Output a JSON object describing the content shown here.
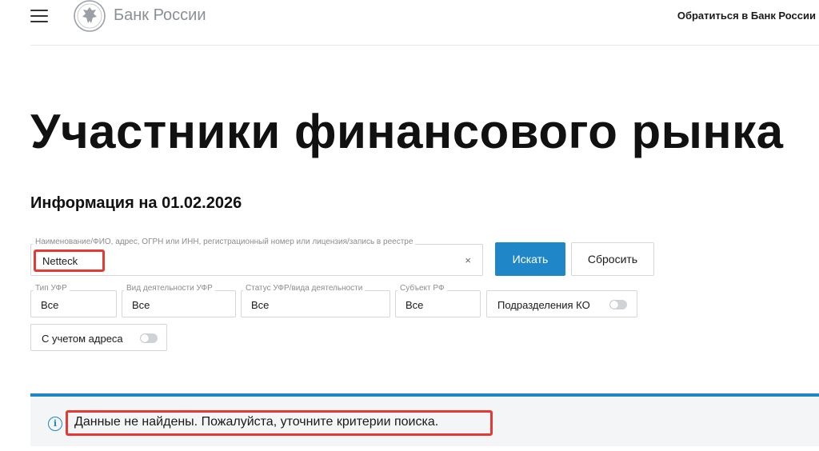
{
  "header": {
    "menu_icon": "hamburger-menu-icon",
    "logo_icon": "bank-emblem-icon",
    "logo_text": "Банк России",
    "contact_link": "Обратиться в Банк России"
  },
  "page": {
    "title": "Участники финансового рынка",
    "info_date": "Информация на 01.02.2026"
  },
  "search": {
    "label": "Наименование/ФИО, адрес, ОГРН или ИНН, регистрационный номер или лицензия/запись в реестре",
    "value": "Netteck",
    "clear_icon": "×",
    "search_button": "Искать",
    "reset_button": "Сбросить"
  },
  "filters": {
    "type": {
      "label": "Тип УФР",
      "value": "Все"
    },
    "activity": {
      "label": "Вид деятельности УФР",
      "value": "Все"
    },
    "status": {
      "label": "Статус УФР/вида деятельности",
      "value": "Все"
    },
    "subject": {
      "label": "Субъект РФ",
      "value": "Все"
    },
    "ko_toggle": {
      "label": "Подразделения КО",
      "on": false
    },
    "address_toggle": {
      "label": "С учетом адреса",
      "on": false
    }
  },
  "result": {
    "icon": "info-icon",
    "icon_glyph": "i",
    "message": "Данные не найдены. Пожалуйста, уточните критерии поиска."
  },
  "colors": {
    "accent": "#1f86c8",
    "highlight": "#e53935",
    "result_bg": "#f4f5f7"
  }
}
